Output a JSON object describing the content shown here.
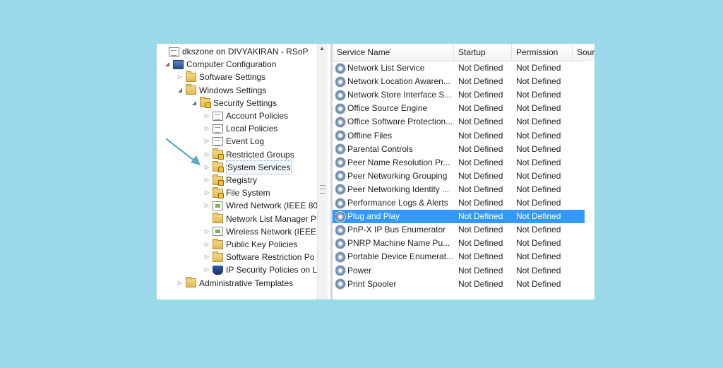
{
  "tree": {
    "nodes": [
      {
        "label": "dkszone on DIVYAKIRAN - RSoP",
        "icon": "document-icon",
        "toggle": ""
      },
      {
        "label": "Computer Configuration",
        "icon": "computer-icon",
        "toggle": "◢"
      },
      {
        "label": "Software Settings",
        "icon": "folder-icon",
        "toggle": "▷"
      },
      {
        "label": "Windows Settings",
        "icon": "folder-icon",
        "toggle": "◢"
      },
      {
        "label": "Security Settings",
        "icon": "security-folder-icon",
        "toggle": "◢"
      },
      {
        "label": "Account Policies",
        "icon": "policy-document-icon",
        "toggle": "▷"
      },
      {
        "label": "Local Policies",
        "icon": "policy-document-icon",
        "toggle": "▷"
      },
      {
        "label": "Event Log",
        "icon": "policy-document-icon",
        "toggle": "▷"
      },
      {
        "label": "Restricted Groups",
        "icon": "locked-folder-icon",
        "toggle": "▷"
      },
      {
        "label": "System Services",
        "icon": "locked-folder-icon",
        "toggle": "▷"
      },
      {
        "label": "Registry",
        "icon": "locked-folder-icon",
        "toggle": "▷"
      },
      {
        "label": "File System",
        "icon": "locked-folder-icon",
        "toggle": "▷"
      },
      {
        "label": "Wired Network (IEEE 80",
        "icon": "network-icon",
        "toggle": "▷"
      },
      {
        "label": "Network List Manager P",
        "icon": "folder-icon",
        "toggle": ""
      },
      {
        "label": "Wireless Network (IEEE",
        "icon": "network-icon",
        "toggle": "▷"
      },
      {
        "label": "Public Key Policies",
        "icon": "folder-icon",
        "toggle": "▷"
      },
      {
        "label": "Software Restriction Po",
        "icon": "folder-icon",
        "toggle": "▷"
      },
      {
        "label": "IP Security Policies on L",
        "icon": "shield-icon",
        "toggle": "▷"
      },
      {
        "label": "Administrative Templates",
        "icon": "folder-icon",
        "toggle": "▷"
      }
    ],
    "selected_label": "System Services"
  },
  "list": {
    "columns": [
      "Service Name",
      "Startup",
      "Permission",
      "Sour"
    ],
    "sort_indicator": "^",
    "rows": [
      {
        "name": "Network List Service",
        "startup": "Not Defined",
        "permission": "Not Defined"
      },
      {
        "name": "Network Location Awaren...",
        "startup": "Not Defined",
        "permission": "Not Defined"
      },
      {
        "name": "Network Store Interface S...",
        "startup": "Not Defined",
        "permission": "Not Defined"
      },
      {
        "name": "Office  Source Engine",
        "startup": "Not Defined",
        "permission": "Not Defined"
      },
      {
        "name": "Office Software Protection...",
        "startup": "Not Defined",
        "permission": "Not Defined"
      },
      {
        "name": "Offline Files",
        "startup": "Not Defined",
        "permission": "Not Defined"
      },
      {
        "name": "Parental Controls",
        "startup": "Not Defined",
        "permission": "Not Defined"
      },
      {
        "name": "Peer Name Resolution Pr...",
        "startup": "Not Defined",
        "permission": "Not Defined"
      },
      {
        "name": "Peer Networking Grouping",
        "startup": "Not Defined",
        "permission": "Not Defined"
      },
      {
        "name": "Peer Networking Identity ...",
        "startup": "Not Defined",
        "permission": "Not Defined"
      },
      {
        "name": "Performance Logs & Alerts",
        "startup": "Not Defined",
        "permission": "Not Defined"
      },
      {
        "name": "Plug and Play",
        "startup": "Not Defined",
        "permission": "Not Defined"
      },
      {
        "name": "PnP-X IP Bus Enumerator",
        "startup": "Not Defined",
        "permission": "Not Defined"
      },
      {
        "name": "PNRP Machine Name Pu...",
        "startup": "Not Defined",
        "permission": "Not Defined"
      },
      {
        "name": "Portable Device Enumerat...",
        "startup": "Not Defined",
        "permission": "Not Defined"
      },
      {
        "name": "Power",
        "startup": "Not Defined",
        "permission": "Not Defined"
      },
      {
        "name": "Print Spooler",
        "startup": "Not Defined",
        "permission": "Not Defined"
      }
    ],
    "selected_name": "Plug and Play"
  },
  "colors": {
    "background": "#9ad9ea",
    "selection": "#3399ff",
    "arrow": "#5aa9cf"
  }
}
